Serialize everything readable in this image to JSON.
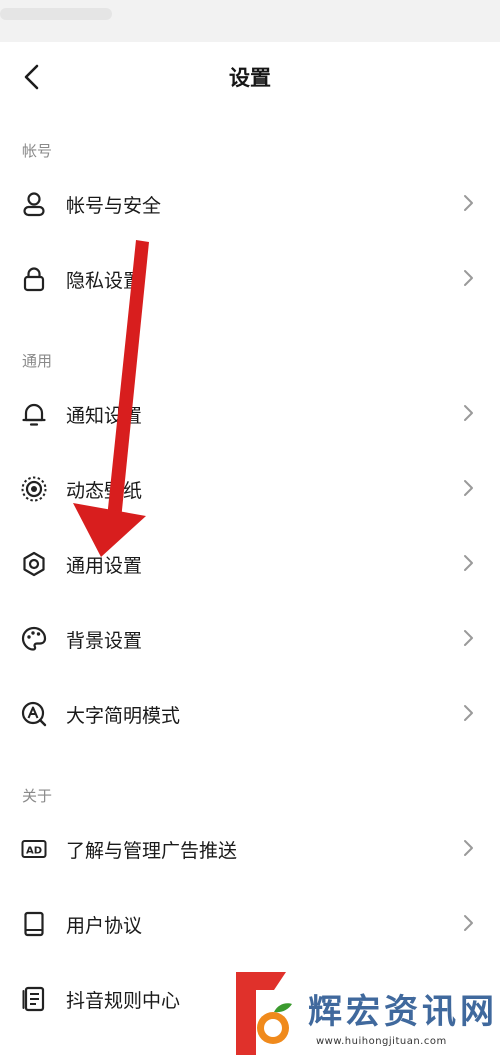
{
  "header": {
    "title": "设置"
  },
  "sections": [
    {
      "label": "帐号"
    },
    {
      "label": "通用"
    },
    {
      "label": "关于"
    }
  ],
  "items": [
    {
      "label": "帐号与安全",
      "icon": "person-icon"
    },
    {
      "label": "隐私设置",
      "icon": "lock-icon"
    },
    {
      "label": "通知设置",
      "icon": "bell-icon"
    },
    {
      "label": "动态壁纸",
      "icon": "dynamic-wallpaper-icon"
    },
    {
      "label": "通用设置",
      "icon": "gear-icon"
    },
    {
      "label": "背景设置",
      "icon": "palette-icon"
    },
    {
      "label": "大字简明模式",
      "icon": "large-font-icon"
    },
    {
      "label": "了解与管理广告推送",
      "icon": "ad-icon"
    },
    {
      "label": "用户协议",
      "icon": "book-icon"
    },
    {
      "label": "抖音规则中心",
      "icon": "rules-document-icon"
    }
  ],
  "watermark": {
    "text": "辉宏资讯网",
    "url": "www.huihongjituan.com"
  },
  "colors": {
    "annotation_arrow": "#d81e1e",
    "section_label": "#8a8a8a",
    "chevron": "#9a9a9a"
  }
}
